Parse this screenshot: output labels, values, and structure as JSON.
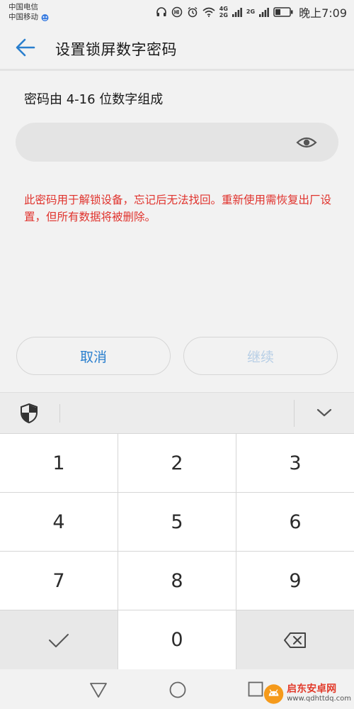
{
  "status_bar": {
    "carrier_1": "中国电信",
    "carrier_2": "中国移动",
    "net_1": "4G",
    "net_2": "2G",
    "net_3": "2G",
    "time": "晚上7:09"
  },
  "title_bar": {
    "title": "设置锁屏数字密码"
  },
  "form": {
    "hint": "密码由 4-16 位数字组成",
    "password_value": "",
    "warning": "此密码用于解锁设备，忘记后无法找回。重新使用需恢复出厂设置，但所有数据将被删除。"
  },
  "buttons": {
    "cancel_label": "取消",
    "continue_label": "继续"
  },
  "keypad": {
    "keys": [
      "1",
      "2",
      "3",
      "4",
      "5",
      "6",
      "7",
      "8",
      "9",
      "0"
    ]
  },
  "watermark": {
    "title": "启东安卓网",
    "url": "www.qdhttdq.com"
  },
  "colors": {
    "accent": "#2a7fce",
    "warning": "#e0332d",
    "disabled": "#b8cfe6"
  }
}
